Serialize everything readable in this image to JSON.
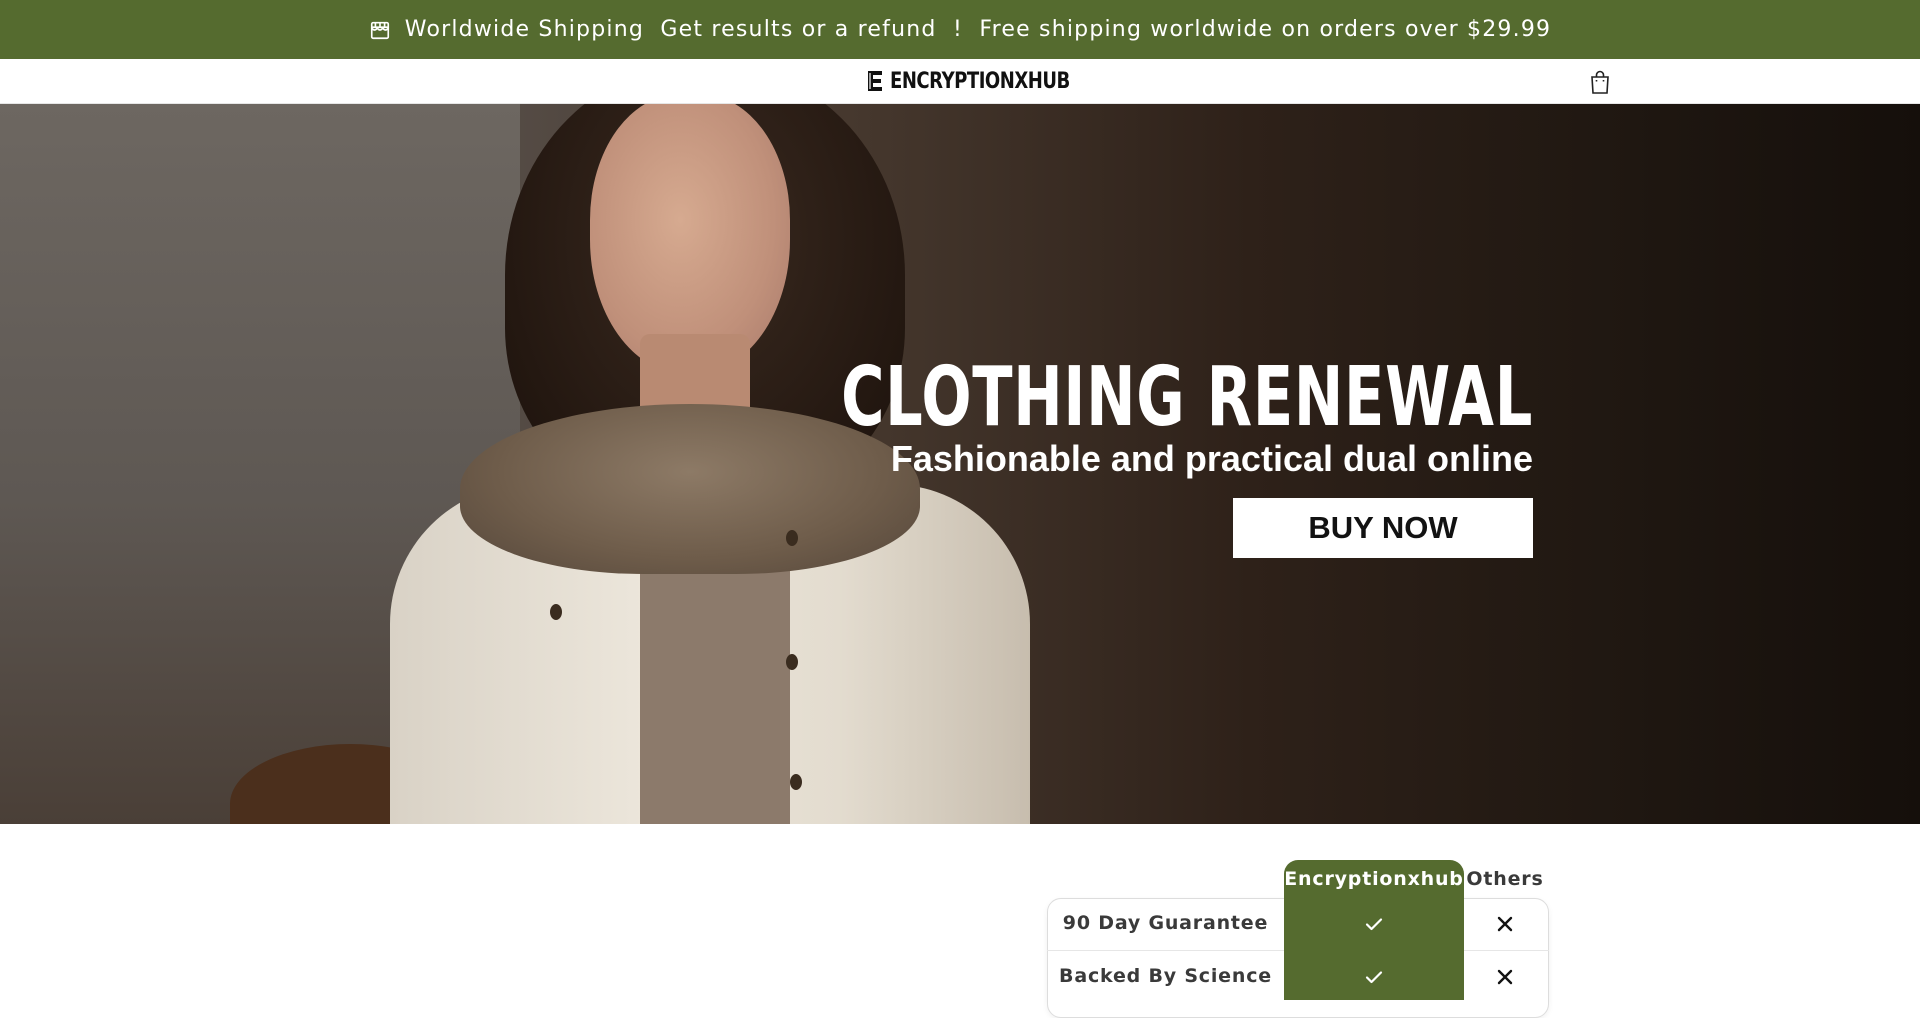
{
  "announcement": {
    "icon": "store-icon",
    "part1": "Worldwide Shipping",
    "part2": "Get results or a refund  !",
    "part3": "Free shipping worldwide on orders over $29.99",
    "background": "#556b2f"
  },
  "header": {
    "logo_text": "ENCRYPTIONXHUB",
    "cart_icon": "shopping-bag-icon"
  },
  "hero": {
    "title": "CLOTHING RENEWAL",
    "subtitle": "Fashionable and practical dual online",
    "button_label": "BUY NOW"
  },
  "comparison": {
    "brand_header": "Encryptionxhub",
    "others_header": "Others",
    "accent": "#556b2f",
    "rows": [
      {
        "label": "90 Day Guarantee",
        "brand": "check-icon",
        "others": "x-icon"
      },
      {
        "label": "Backed By Science",
        "brand": "check-icon",
        "others": "x-icon"
      }
    ]
  }
}
